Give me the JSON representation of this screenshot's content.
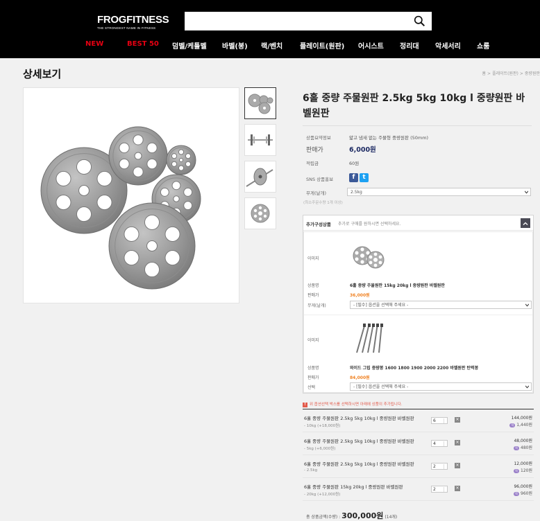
{
  "header": {
    "logo_title": "FROGFITNESS",
    "logo_tagline": "THE STRONGEST NAME IN FITNESS",
    "search_placeholder": "",
    "nav": [
      {
        "label": "NEW",
        "color": "#e60012"
      },
      {
        "label": "BEST 50",
        "color": "#e60012"
      },
      {
        "label": "덤벨/케틀벨",
        "color": "#ffffff"
      },
      {
        "label": "바벨(봉)",
        "color": "#ffffff"
      },
      {
        "label": "랙/벤치",
        "color": "#ffffff"
      },
      {
        "label": "플레이트(원판)",
        "color": "#ffffff"
      },
      {
        "label": "어시스트",
        "color": "#ffffff"
      },
      {
        "label": "정리대",
        "color": "#ffffff"
      },
      {
        "label": "악세서리",
        "color": "#ffffff"
      },
      {
        "label": "쇼룸",
        "color": "#ffffff"
      }
    ]
  },
  "page": {
    "title": "상세보기",
    "breadcrumb": [
      "홈",
      "플레이트(원판)",
      "중량원판"
    ]
  },
  "product": {
    "name": "6홀 중량 주물원판 2.5kg 5kg 10kg l 중량원판 바벨원판",
    "summary_label": "상품요약정보",
    "summary_value": "얇고 냄새 없는 주물형 중량원판 (50mm)",
    "price_label": "판매가",
    "price_value": "6,000원",
    "points_label": "적립금",
    "points_value": "60원",
    "sns_label": "SNS 상품홍보",
    "sns": [
      "f",
      "t"
    ],
    "option_label": "무게(날개)",
    "option_value": "2.5kg",
    "min_qty_note": "(최소주문수량 1개 이상)"
  },
  "addon": {
    "title": "추가구성상품",
    "subtitle": "추가로 구매를 원하시면 선택하세요.",
    "items": [
      {
        "image_label": "이미지",
        "name_label": "상품명",
        "name": "6홀 중량 주물원판 15kg 20kg l 중량원판 바벨원판",
        "price_label": "판매가",
        "price": "36,000원",
        "option_label": "무게(날개)",
        "option_value": "- [필수] 옵션을 선택해 주세요 -"
      },
      {
        "image_label": "이미지",
        "name_label": "상품명",
        "name": "와이드 그립 중량봉 1600 1800 1900 2000 2200 바벨원판 탄력봉",
        "price_label": "판매가",
        "price": "84,000원",
        "option_label": "선택",
        "option_value": "- [필수] 옵션을 선택해 주세요 -"
      }
    ]
  },
  "warning": "위 옵션선택 박스를 선택하시면 아래에 상품이 추가됩니다.",
  "selected": [
    {
      "name": "6홀 중량 주물원판 2.5kg 5kg 10kg l 중량원판 바벨원판",
      "option": "- 10kg (+18,000원)",
      "qty": "6",
      "price": "144,000원",
      "points": "1,440원"
    },
    {
      "name": "6홀 중량 주물원판 2.5kg 5kg 10kg l 중량원판 바벨원판",
      "option": "- 5kg (+6,000원)",
      "qty": "4",
      "price": "48,000원",
      "points": "480원"
    },
    {
      "name": "6홀 중량 주물원판 2.5kg 5kg 10kg l 중량원판 바벨원판",
      "option": "- 2.5kg",
      "qty": "2",
      "price": "12,000원",
      "points": "120원"
    },
    {
      "name": "6홀 중량 주물원판 15kg 20kg l 중량원판 바벨원판",
      "option": "- 20kg (+12,000원)",
      "qty": "2",
      "price": "96,000원",
      "points": "960원"
    }
  ],
  "total": {
    "label": "총 상품금액(수량) :",
    "value": "300,000원",
    "count": "(14개)"
  },
  "colors": {
    "header_bg": "#000000",
    "price": "#1d2a63",
    "addon_price": "#f08324",
    "warning": "#e25b4c",
    "points_badge": "#9a80c9"
  },
  "icons": {
    "search": "search-icon",
    "facebook": "facebook-icon",
    "twitter": "twitter-icon",
    "collapse": "chevron-up-icon",
    "remove": "close-icon"
  }
}
